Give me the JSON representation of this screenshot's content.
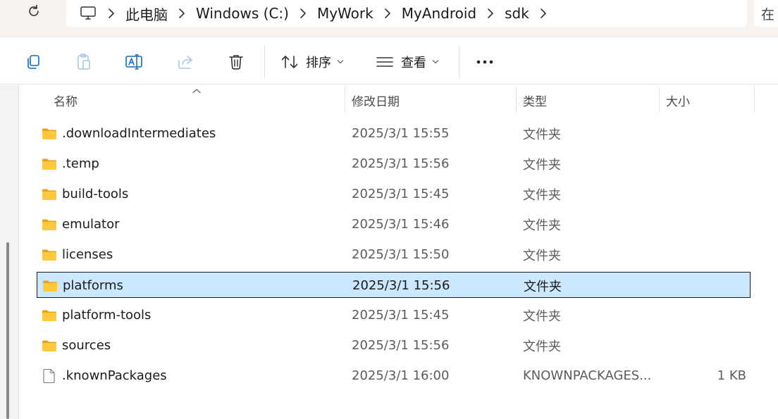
{
  "address": {
    "breadcrumbs": [
      "此电脑",
      "Windows (C:)",
      "MyWork",
      "MyAndroid",
      "sdk"
    ],
    "search_partial": "在"
  },
  "toolbar": {
    "sort_label": "排序",
    "view_label": "查看"
  },
  "columns": {
    "name": "名称",
    "modified": "修改日期",
    "type": "类型",
    "size": "大小"
  },
  "files": [
    {
      "name": ".downloadIntermediates",
      "modified": "2025/3/1 15:55",
      "type": "文件夹",
      "size": "",
      "icon": "folder-icon"
    },
    {
      "name": ".temp",
      "modified": "2025/3/1 15:56",
      "type": "文件夹",
      "size": "",
      "icon": "folder-icon"
    },
    {
      "name": "build-tools",
      "modified": "2025/3/1 15:45",
      "type": "文件夹",
      "size": "",
      "icon": "folder-icon"
    },
    {
      "name": "emulator",
      "modified": "2025/3/1 15:46",
      "type": "文件夹",
      "size": "",
      "icon": "folder-icon"
    },
    {
      "name": "licenses",
      "modified": "2025/3/1 15:50",
      "type": "文件夹",
      "size": "",
      "icon": "folder-icon"
    },
    {
      "name": "platforms",
      "modified": "2025/3/1 15:56",
      "type": "文件夹",
      "size": "",
      "icon": "folder-icon",
      "selected": true
    },
    {
      "name": "platform-tools",
      "modified": "2025/3/1 15:45",
      "type": "文件夹",
      "size": "",
      "icon": "folder-icon"
    },
    {
      "name": "sources",
      "modified": "2025/3/1 15:56",
      "type": "文件夹",
      "size": "",
      "icon": "folder-icon"
    },
    {
      "name": ".knownPackages",
      "modified": "2025/3/1 16:00",
      "type": "KNOWNPACKAGES...",
      "size": "1 KB",
      "icon": "file-icon"
    }
  ],
  "colors": {
    "selection_fill": "#cce8ff",
    "folder_fill": "#ffc83d",
    "folder_back": "#e8a317"
  }
}
